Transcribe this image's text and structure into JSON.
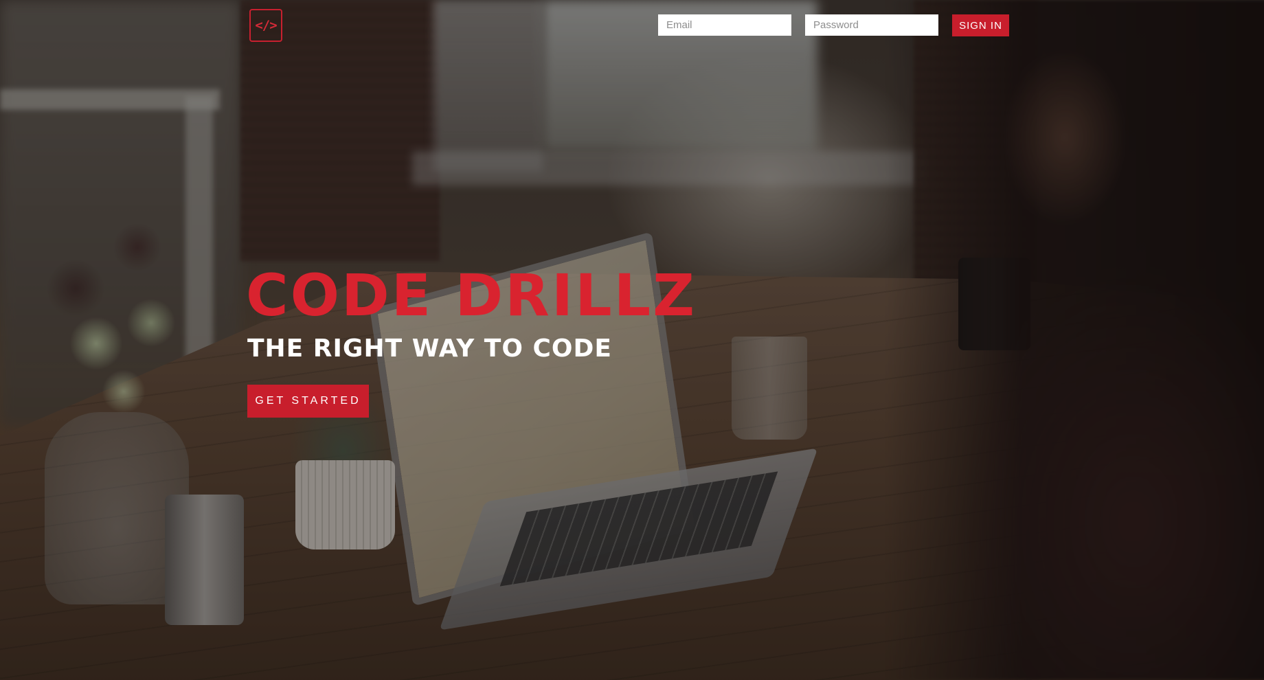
{
  "header": {
    "logo_icon": "code-brackets-icon",
    "logo_glyph": "</>",
    "email_placeholder": "Email",
    "password_placeholder": "Password",
    "signin_label": "SIGN IN"
  },
  "hero": {
    "title": "CODE DRILLZ",
    "subtitle": "THE RIGHT WAY TO CODE",
    "cta_label": "GET STARTED"
  },
  "colors": {
    "accent": "#c81e2c",
    "title": "#d9232f",
    "text_light": "#ffffff"
  }
}
